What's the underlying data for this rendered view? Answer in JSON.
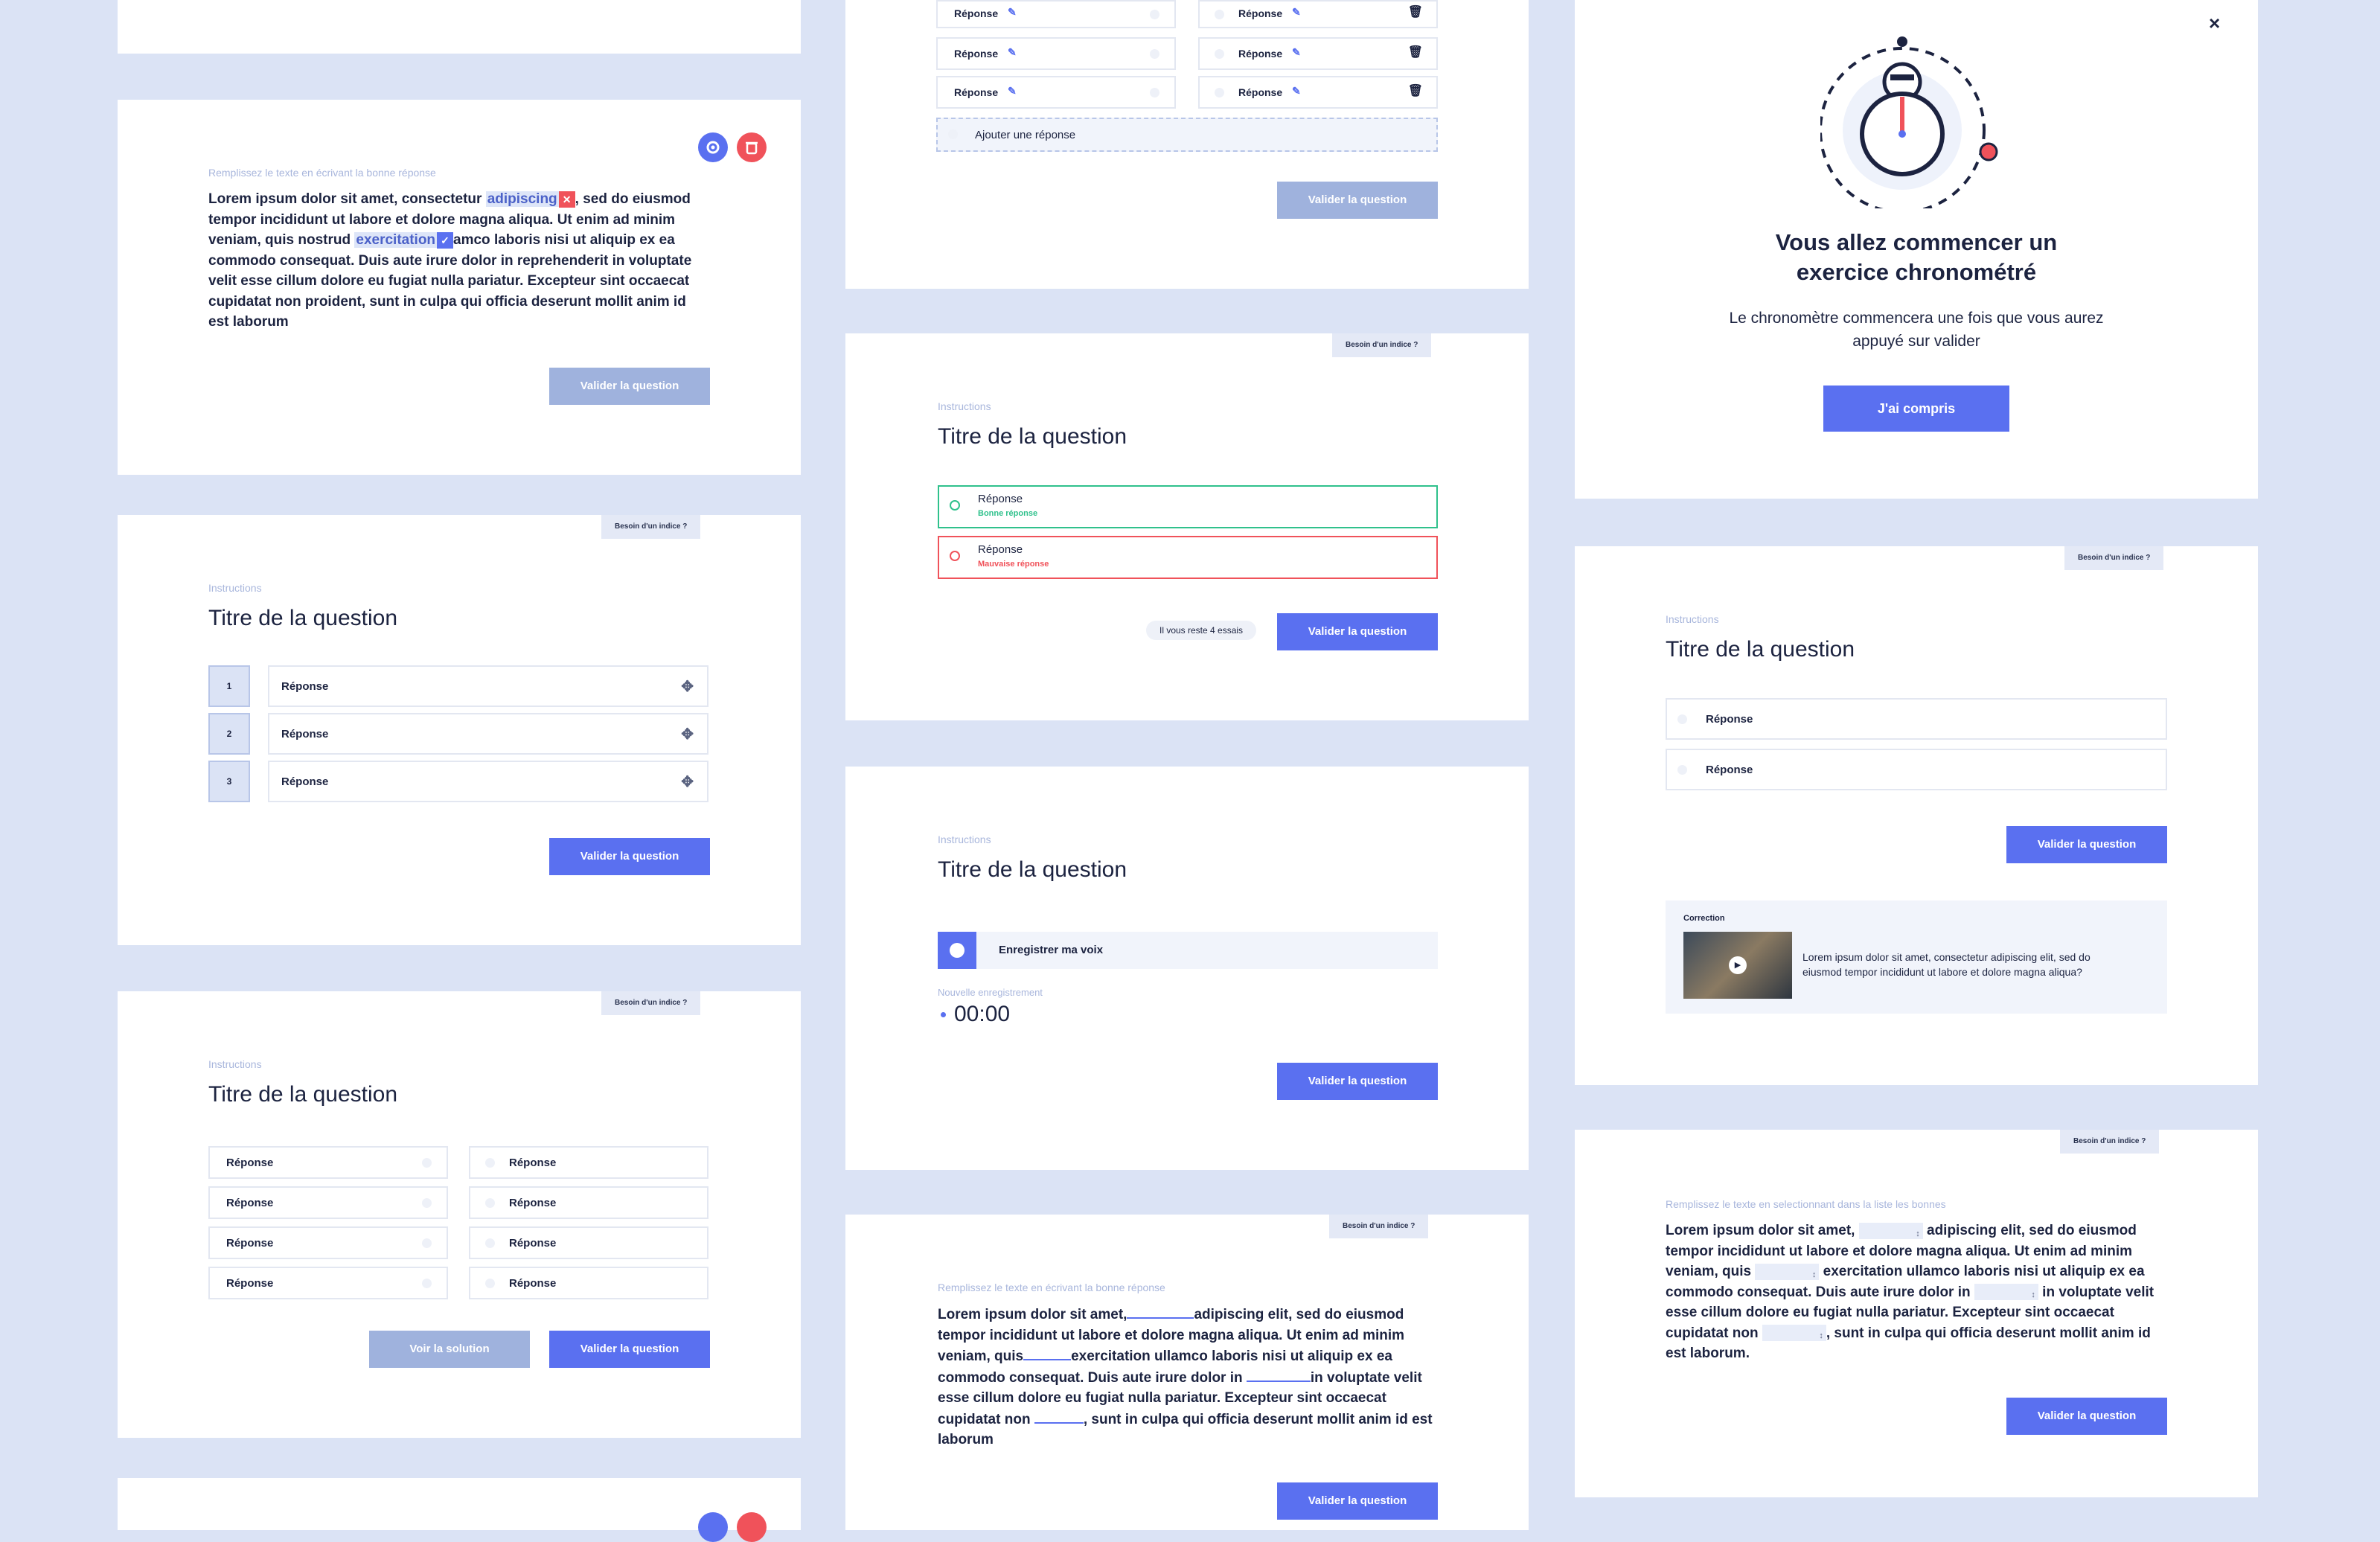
{
  "common": {
    "hint_label": "Besoin d'un indice ?",
    "instructions": "Instructions",
    "question_title": "Titre de la question",
    "validate_label": "Valider la question",
    "answer_label": "Réponse"
  },
  "fill_text": {
    "instruction": "Remplissez le texte en écrivant la bonne réponse",
    "p1": "Lorem ipsum dolor sit amet, consectetur ",
    "word1": "adipiscing",
    "p2": ", sed do eiusmod tempor incididunt ut labore et dolore magna aliqua. Ut enim ad minim veniam, quis nostrud ",
    "word2": "exercitation",
    "p3": "amco laboris nisi ut aliquip ex ea commodo consequat. Duis aute irure dolor in reprehenderit in voluptate velit esse cillum dolore eu fugiat nulla pariatur. Excepteur sint occaecat cupidatat non proident, sunt in culpa qui officia deserunt mollit anim id est laborum"
  },
  "ordering": {
    "numbers": [
      "1",
      "2",
      "3"
    ]
  },
  "matching": {
    "show_solution_label": "Voir la solution"
  },
  "editor": {
    "add_answer_label": "Ajouter une réponse"
  },
  "feedback": {
    "good_label": "Bonne réponse",
    "bad_label": "Mauvaise réponse",
    "tries_label": "Il vous reste 4 essais"
  },
  "voice": {
    "record_label": "Enregistrer ma voix",
    "new_recording_label": "Nouvelle enregistrement",
    "timer": "00:00"
  },
  "blanks": {
    "instruction": "Remplissez le texte en écrivant la bonne réponse",
    "s1": "Lorem ipsum dolor sit amet,",
    "s2": "adipiscing elit, sed do eiusmod tempor incididunt ut labore et dolore magna aliqua. Ut enim ad minim veniam, quis",
    "s3": "exercitation ullamco laboris nisi ut aliquip ex ea commodo consequat. Duis aute irure dolor in",
    "s4": "in voluptate velit esse cillum dolore eu fugiat nulla pariatur. Excepteur sint occaecat cupidatat non",
    "s5": ", sunt in culpa qui officia deserunt mollit anim id est laborum"
  },
  "modal": {
    "title_line1": "Vous allez commencer un",
    "title_line2": "exercice chronométré",
    "body_line1": "Le chronomètre commencera une fois que vous aurez",
    "body_line2": "appuyé sur valider",
    "confirm_label": "J'ai compris"
  },
  "correction": {
    "heading": "Correction",
    "text": "Lorem ipsum dolor sit amet, consectetur adipiscing elit, sed do eiusmod tempor incididunt ut labore et dolore magna aliqua?"
  },
  "select_fill": {
    "instruction": "Remplissez le texte en selectionnant dans la liste les bonnes",
    "s1": "Lorem ipsum dolor sit amet,",
    "s2": "adipiscing elit, sed do eiusmod tempor incididunt ut labore et dolore magna aliqua. Ut enim ad minim veniam, quis",
    "s3": "exercitation ullamco laboris nisi ut aliquip ex ea commodo consequat. Duis aute irure dolor in",
    "s4": "in voluptate velit esse cillum dolore eu fugiat nulla pariatur. Excepteur sint occaecat cupidatat non",
    "s5": ", sunt in culpa qui officia deserunt mollit anim id est laborum."
  },
  "colors": {
    "primary": "#5a70f0",
    "muted_button": "#9fb2dd",
    "success": "#2fc18c",
    "danger": "#f0525a",
    "background": "#dbe3f5"
  }
}
